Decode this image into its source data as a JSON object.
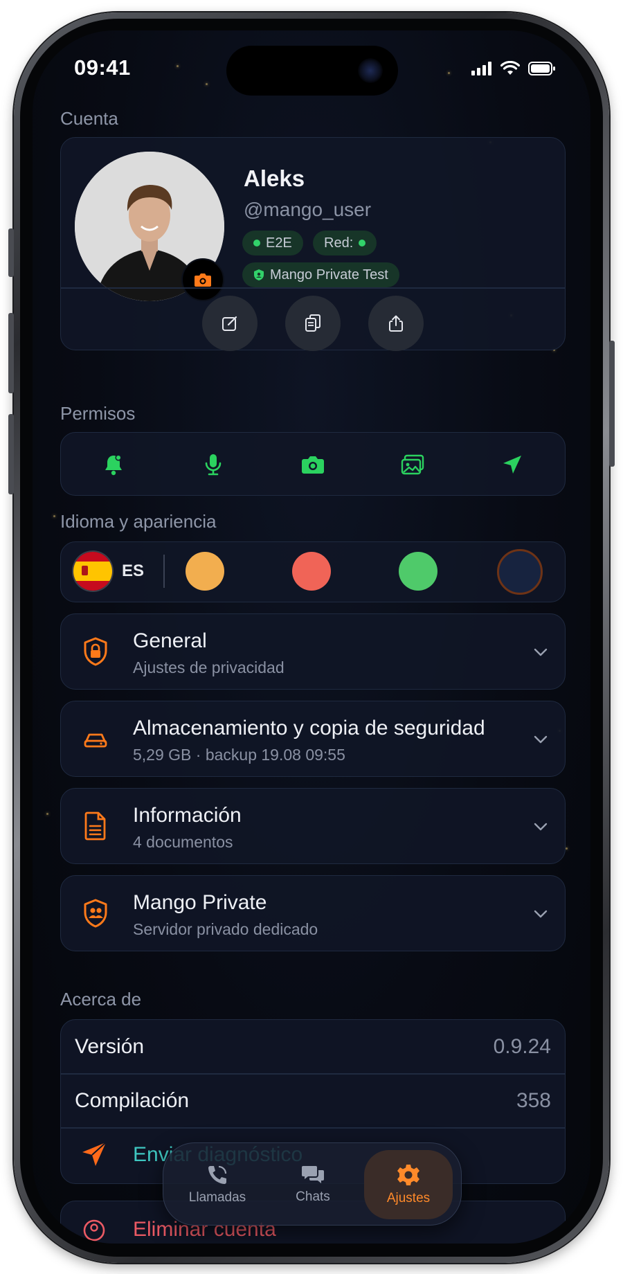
{
  "status_bar": {
    "time": "09:41"
  },
  "sections": {
    "account": "Cuenta",
    "permissions": "Permisos",
    "language_appearance": "Idioma y apariencia",
    "about": "Acerca de"
  },
  "profile": {
    "name": "Aleks",
    "handle": "@mango_user",
    "chips": {
      "e2e": "E2E",
      "network": "Red:",
      "server": "Mango Private Test"
    },
    "actions": [
      "edit-icon",
      "copy-icon",
      "share-icon"
    ]
  },
  "permissions": [
    "bell-icon",
    "microphone-icon",
    "camera-icon",
    "gallery-icon",
    "location-icon"
  ],
  "language": {
    "code": "ES",
    "flag": "spain-flag"
  },
  "themes": [
    {
      "name": "orange",
      "color": "#f2ae4f"
    },
    {
      "name": "red",
      "color": "#f06457"
    },
    {
      "name": "green",
      "color": "#4fca6a"
    },
    {
      "name": "navy",
      "color": "#17233f",
      "selected": true
    }
  ],
  "settings": [
    {
      "title": "General",
      "subtitle": "Ajustes de privacidad",
      "icon": "shield-lock-icon"
    },
    {
      "title": "Almacenamiento y copia de seguridad",
      "subtitle": "5,29 GB · backup 19.08 09:55",
      "icon": "storage-icon"
    },
    {
      "title": "Información",
      "subtitle": "4 documentos",
      "icon": "document-icon"
    },
    {
      "title": "Mango Private",
      "subtitle": "Servidor privado dedicado",
      "icon": "shield-users-icon"
    }
  ],
  "about": {
    "version_label": "Versión",
    "version_value": "0.9.24",
    "build_label": "Compilación",
    "build_value": "358",
    "diagnostics": "Enviar diagnóstico"
  },
  "danger": {
    "delete_account": "Eliminar cuenta"
  },
  "tabbar": [
    {
      "label": "Llamadas",
      "icon": "phone-icon"
    },
    {
      "label": "Chats",
      "icon": "chat-bubbles-icon"
    },
    {
      "label": "Ajustes",
      "icon": "gear-icon",
      "active": true
    }
  ],
  "colors": {
    "accent": "#ff7a1a",
    "permission_green": "#2bd25f",
    "background": "#080b14"
  }
}
